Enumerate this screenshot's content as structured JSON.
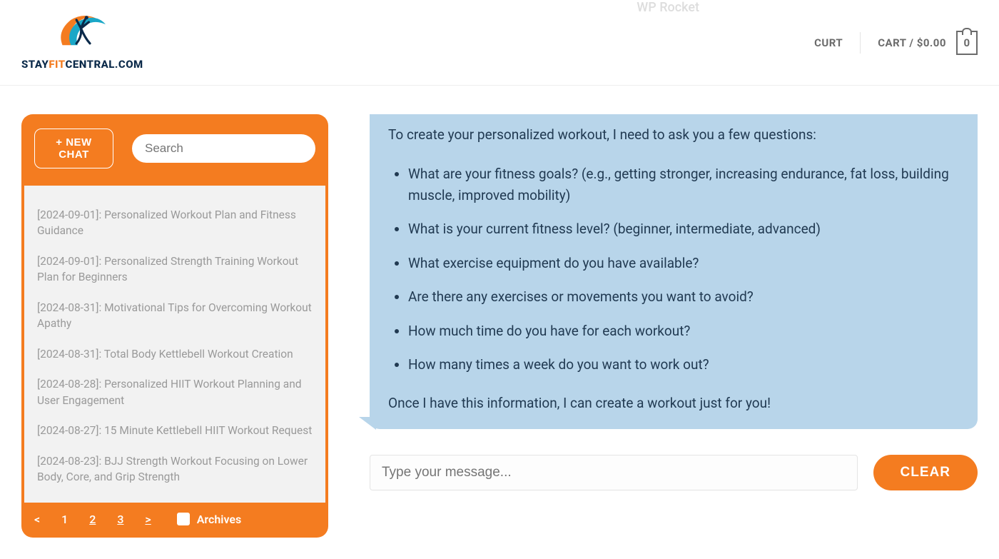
{
  "faint_top_menu": "WP Rocket",
  "header": {
    "logo_text_1": "STAY",
    "logo_text_2": "FIT",
    "logo_text_3": "CENTRAL.COM",
    "user_label": "CURT",
    "cart_label": "CART / $0.00",
    "cart_count": "0"
  },
  "sidebar": {
    "new_chat_label": "+ NEW CHAT",
    "search_placeholder": "Search",
    "items": [
      "[2024-09-01]: Personalized Workout Plan and Fitness Guidance",
      "[2024-09-01]: Personalized Strength Training Workout Plan for Beginners",
      "[2024-08-31]: Motivational Tips for Overcoming Workout Apathy",
      "[2024-08-31]: Total Body Kettlebell Workout Creation",
      "[2024-08-28]: Personalized HIIT Workout Planning and User Engagement",
      "[2024-08-27]: 15 Minute Kettlebell HIIT Workout Request",
      "[2024-08-23]: BJJ Strength Workout Focusing on Lower Body, Core, and Grip Strength"
    ],
    "pager": {
      "prev": "<",
      "p1": "1",
      "p2": "2",
      "p3": "3",
      "next": ">",
      "archives_label": "Archives"
    }
  },
  "chat": {
    "intro": "To create your personalized workout, I need to ask you a few questions:",
    "questions": [
      "What are your fitness goals? (e.g., getting stronger, increasing endurance, fat loss, building muscle, improved mobility)",
      "What is your current fitness level? (beginner, intermediate, advanced)",
      "What exercise equipment do you have available?",
      "Are there any exercises or movements you want to avoid?",
      "How much time do you have for each workout?",
      "How many times a week do you want to work out?"
    ],
    "outro": "Once I have this information, I can create a workout just for you!",
    "input_placeholder": "Type your message...",
    "clear_label": "CLEAR"
  }
}
